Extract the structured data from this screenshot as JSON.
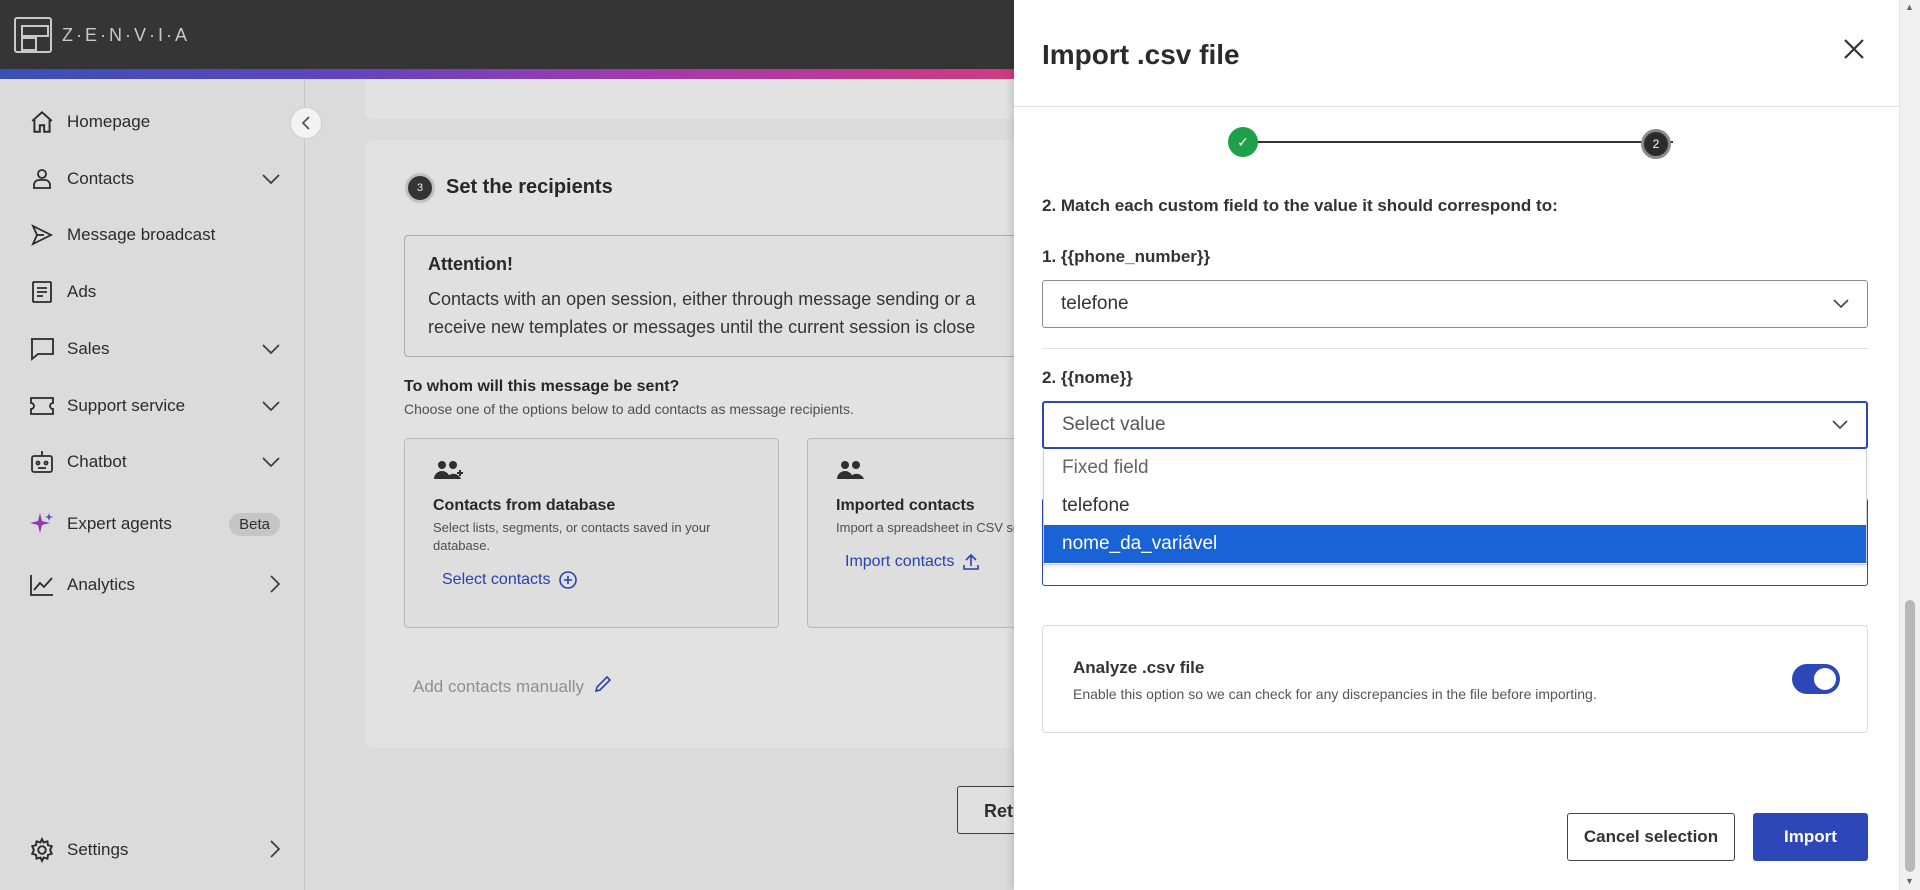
{
  "brand": {
    "name": "Z·E·N·V·I·A"
  },
  "sidebar": {
    "items": [
      {
        "label": "Homepage",
        "icon": "home-icon",
        "chevron": ""
      },
      {
        "label": "Contacts",
        "icon": "user-icon",
        "chevron": "⌄"
      },
      {
        "label": "Message broadcast",
        "icon": "send-icon",
        "chevron": ""
      },
      {
        "label": "Ads",
        "icon": "document-icon",
        "chevron": ""
      },
      {
        "label": "Sales",
        "icon": "chat-bubble-icon",
        "chevron": "⌄"
      },
      {
        "label": "Support service",
        "icon": "ticket-icon",
        "chevron": "⌄"
      },
      {
        "label": "Chatbot",
        "icon": "robot-icon",
        "chevron": "⌄"
      },
      {
        "label": "Expert agents",
        "icon": "sparkle-icon",
        "badge": "Beta"
      },
      {
        "label": "Analytics",
        "icon": "chart-line-icon",
        "chevron": "›"
      }
    ],
    "settings_label": "Settings"
  },
  "main": {
    "step_number": "3",
    "title": "Set the recipients",
    "attention": {
      "heading": "Attention!",
      "line1": "Contacts with an open session, either through message sending or a",
      "line2": "receive new templates or messages until the current session is close"
    },
    "to_whom_title": "To whom will this message be sent?",
    "to_whom_sub": "Choose one of the options below to add contacts as message recipients.",
    "options": [
      {
        "title": "Contacts from database",
        "desc": "Select lists, segments, or contacts saved in your database.",
        "link": "Select contacts"
      },
      {
        "title": "Imported contacts",
        "desc": "Import a spreadsheet in CSV selected contacts.",
        "link": "Import contacts"
      }
    ],
    "add_manual": "Add contacts manually",
    "return_button": "Ret"
  },
  "modal": {
    "title": "Import .csv file",
    "step_done": "✓",
    "step_current": "2",
    "instruction": "2. Match each custom field to the value it should correspond to:",
    "fields": [
      {
        "label": "1. {{phone_number}}",
        "value": "telefone"
      },
      {
        "label": "2. {{nome}}",
        "value": "Select value"
      }
    ],
    "dropdown_options": [
      "Fixed field",
      "telefone",
      "nome_da_variável"
    ],
    "analyze": {
      "title": "Analyze .csv file",
      "desc": "Enable this option so we can check for any discrepancies in the file before importing.",
      "enabled": true
    },
    "cancel_button": "Cancel selection",
    "import_button": "Import"
  },
  "colors": {
    "primary": "#2e47b8",
    "success": "#1ea04a",
    "dark": "#3a3a3a",
    "selected": "#1a63d6"
  }
}
